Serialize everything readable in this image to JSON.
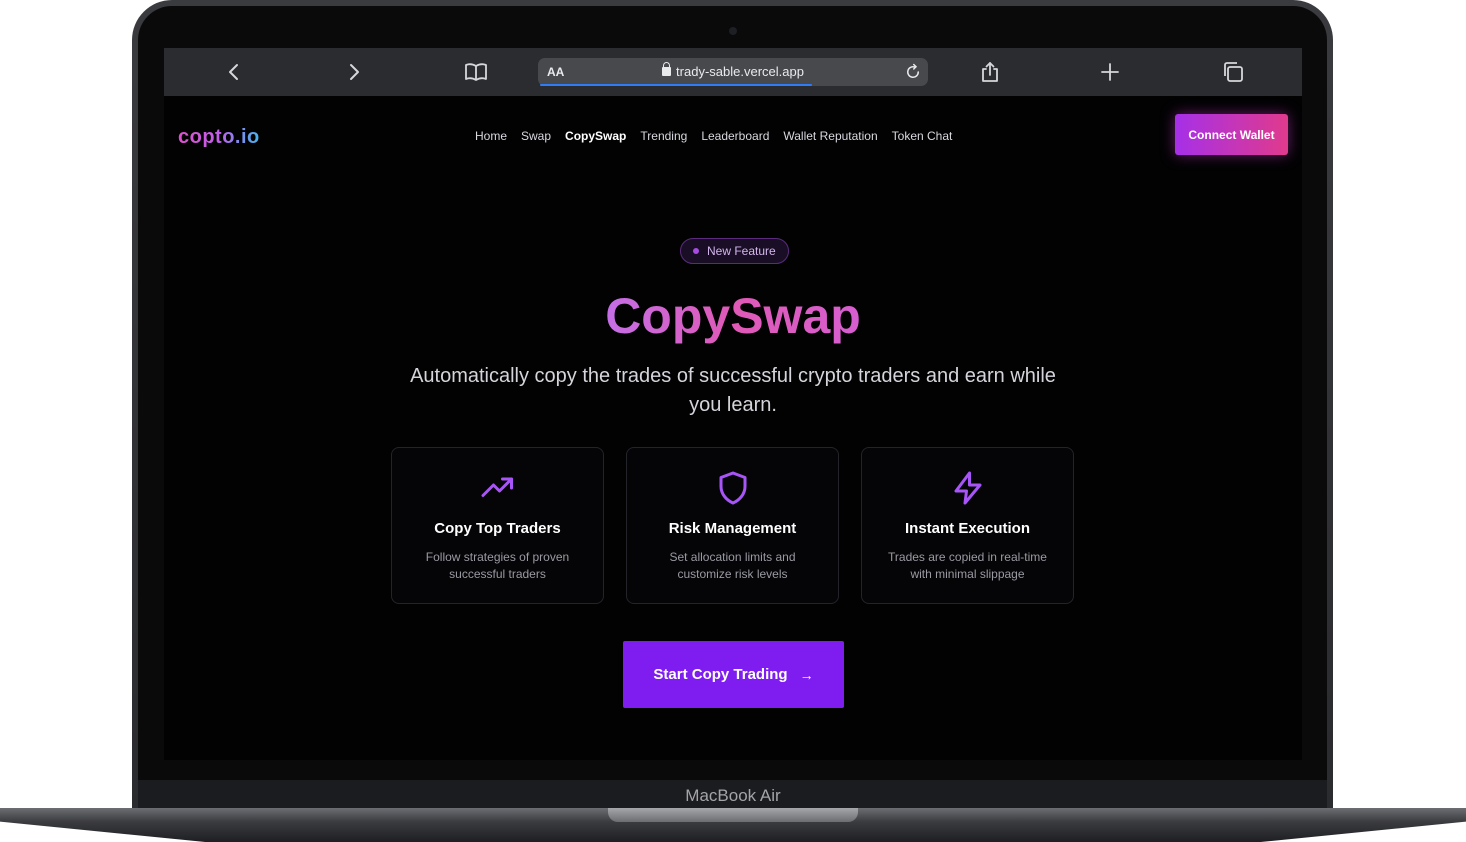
{
  "device": {
    "model_label": "MacBook Air"
  },
  "browser": {
    "url_aa": "AA",
    "url": "trady-sable.vercel.app",
    "icons": [
      "back-icon",
      "forward-icon",
      "bookmarks-icon",
      "lock-icon",
      "reload-icon",
      "share-icon",
      "new-tab-icon",
      "tabs-icon"
    ]
  },
  "site": {
    "logo": "copto.io",
    "nav": [
      {
        "label": "Home"
      },
      {
        "label": "Swap"
      },
      {
        "label": "CopySwap",
        "active": true
      },
      {
        "label": "Trending"
      },
      {
        "label": "Leaderboard"
      },
      {
        "label": "Wallet Reputation"
      },
      {
        "label": "Token Chat"
      }
    ],
    "connect_label": "Connect Wallet"
  },
  "hero": {
    "badge": "New Feature",
    "title": "CopySwap",
    "subtitle": "Automatically copy the trades of successful crypto traders and earn while you learn."
  },
  "features": [
    {
      "icon": "trending-up-icon",
      "title": "Copy Top Traders",
      "desc": "Follow strategies of proven successful traders"
    },
    {
      "icon": "shield-icon",
      "title": "Risk Management",
      "desc": "Set allocation limits and customize risk levels"
    },
    {
      "icon": "lightning-icon",
      "title": "Instant Execution",
      "desc": "Trades are copied in real-time with minimal slippage"
    }
  ],
  "cta": {
    "label": "Start Copy Trading",
    "arrow": "→"
  },
  "colors": {
    "accent": "#7f1df0",
    "icon_purple": "#a855f7",
    "background": "#020203"
  }
}
